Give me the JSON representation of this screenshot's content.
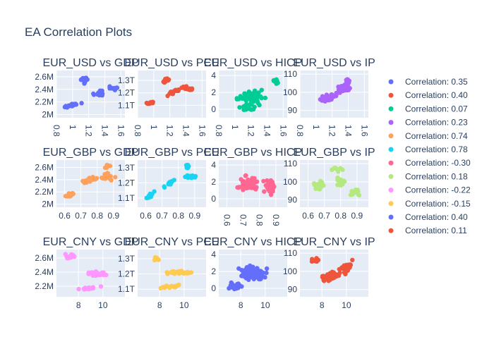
{
  "title": "EA Correlation Plots",
  "colors": {
    "plot_bg": "#e5ecf6",
    "grid": "#ffffff",
    "text": "#2a3f5f",
    "series": [
      "#636efa",
      "#ef553b",
      "#00cc96",
      "#ab63fa",
      "#ffa15a",
      "#19d3f3",
      "#ff6692",
      "#b6e880",
      "#ff97ff",
      "#fecb52",
      "#636efa",
      "#ef553b"
    ]
  },
  "legend": {
    "placement": "right",
    "entries": [
      "Correlation: 0.35",
      "Correlation: 0.40",
      "Correlation: 0.07",
      "Correlation: 0.23",
      "Correlation: 0.74",
      "Correlation: 0.78",
      "Correlation: -0.30",
      "Correlation: 0.18",
      "Correlation: -0.22",
      "Correlation: -0.15",
      "Correlation: 0.40",
      "Correlation: 0.11"
    ]
  },
  "chart_data": [
    {
      "type": "scatter",
      "title": "EUR_USD vs GDP",
      "xlim": [
        0.8,
        1.65
      ],
      "ylim": [
        1.95,
        2.7
      ],
      "xticks": [
        {
          "v": 0.8,
          "t": "0.8"
        },
        {
          "v": 1,
          "t": "1"
        },
        {
          "v": 1.2,
          "t": "1.2"
        },
        {
          "v": 1.4,
          "t": "1.4"
        },
        {
          "v": 1.6,
          "t": "1.6"
        }
      ],
      "yticks": [
        {
          "v": 2.0,
          "t": "2M"
        },
        {
          "v": 2.2,
          "t": "2.2M"
        },
        {
          "v": 2.4,
          "t": "2.4M"
        },
        {
          "v": 2.6,
          "t": "2.6M"
        }
      ],
      "xtick_rotate": true,
      "gen": "usd_gdp"
    },
    {
      "type": "scatter",
      "title": "EUR_USD vs PCE",
      "xlim": [
        0.8,
        1.65
      ],
      "ylim": [
        1.0,
        1.38
      ],
      "xticks": [
        {
          "v": 0.8,
          "t": "0.8"
        },
        {
          "v": 1,
          "t": "1"
        },
        {
          "v": 1.2,
          "t": "1.2"
        },
        {
          "v": 1.4,
          "t": "1.4"
        },
        {
          "v": 1.6,
          "t": "1.6"
        }
      ],
      "yticks": [
        {
          "v": 1.1,
          "t": "1.1T"
        },
        {
          "v": 1.2,
          "t": "1.2T"
        },
        {
          "v": 1.3,
          "t": "1.3T"
        }
      ],
      "xtick_rotate": true,
      "gen": "usd_pce"
    },
    {
      "type": "scatter",
      "title": "EUR_USD vs HICP",
      "xlim": [
        0.8,
        1.65
      ],
      "ylim": [
        -1,
        4.6
      ],
      "xticks": [
        {
          "v": 0.8,
          "t": "0.8"
        },
        {
          "v": 1,
          "t": "1"
        },
        {
          "v": 1.2,
          "t": "1.2"
        },
        {
          "v": 1.4,
          "t": "1.4"
        },
        {
          "v": 1.6,
          "t": "1.6"
        }
      ],
      "yticks": [
        {
          "v": 0,
          "t": "0"
        },
        {
          "v": 2,
          "t": "2"
        },
        {
          "v": 4,
          "t": "4"
        }
      ],
      "xtick_rotate": true,
      "gen": "usd_hicp"
    },
    {
      "type": "scatter",
      "title": "EUR_USD vs IP",
      "xlim": [
        0.8,
        1.65
      ],
      "ylim": [
        86,
        112
      ],
      "xticks": [
        {
          "v": 0.8,
          "t": "0.8"
        },
        {
          "v": 1,
          "t": "1"
        },
        {
          "v": 1.2,
          "t": "1.2"
        },
        {
          "v": 1.4,
          "t": "1.4"
        },
        {
          "v": 1.6,
          "t": "1.6"
        }
      ],
      "yticks": [
        {
          "v": 90,
          "t": "90"
        },
        {
          "v": 100,
          "t": "100"
        },
        {
          "v": 110,
          "t": "110"
        }
      ],
      "xtick_rotate": true,
      "gen": "usd_ip"
    },
    {
      "type": "scatter",
      "title": "EUR_GBP vs GDP",
      "xlim": [
        0.55,
        0.97
      ],
      "ylim": [
        1.95,
        2.72
      ],
      "xticks": [
        {
          "v": 0.6,
          "t": "0.6"
        },
        {
          "v": 0.7,
          "t": "0.7"
        },
        {
          "v": 0.8,
          "t": "0.8"
        },
        {
          "v": 0.9,
          "t": "0.9"
        }
      ],
      "yticks": [
        {
          "v": 2.0,
          "t": "2M"
        },
        {
          "v": 2.2,
          "t": "2.2M"
        },
        {
          "v": 2.4,
          "t": "2.4M"
        },
        {
          "v": 2.6,
          "t": "2.6M"
        }
      ],
      "xtick_rotate": false,
      "gen": "gbp_gdp"
    },
    {
      "type": "scatter",
      "title": "EUR_GBP vs PCE",
      "xlim": [
        0.55,
        0.97
      ],
      "ylim": [
        1.04,
        1.35
      ],
      "xticks": [
        {
          "v": 0.6,
          "t": "0.6"
        },
        {
          "v": 0.7,
          "t": "0.7"
        },
        {
          "v": 0.8,
          "t": "0.8"
        },
        {
          "v": 0.9,
          "t": "0.9"
        }
      ],
      "yticks": [
        {
          "v": 1.1,
          "t": "1.1T"
        },
        {
          "v": 1.2,
          "t": "1.2T"
        },
        {
          "v": 1.3,
          "t": "1.3T"
        }
      ],
      "xtick_rotate": false,
      "gen": "gbp_pce"
    },
    {
      "type": "scatter",
      "title": "EUR_GBP vs HICP",
      "xlim": [
        0.55,
        0.97
      ],
      "ylim": [
        -1,
        4.6
      ],
      "xticks": [
        {
          "v": 0.6,
          "t": "0.6"
        },
        {
          "v": 0.7,
          "t": "0.7"
        },
        {
          "v": 0.8,
          "t": "0.8"
        },
        {
          "v": 0.9,
          "t": "0.9"
        }
      ],
      "yticks": [
        {
          "v": 0,
          "t": "0"
        },
        {
          "v": 2,
          "t": "2"
        },
        {
          "v": 4,
          "t": "4"
        }
      ],
      "xtick_rotate": true,
      "gen": "gbp_hicp"
    },
    {
      "type": "scatter",
      "title": "EUR_GBP vs IP",
      "xlim": [
        0.55,
        0.97
      ],
      "ylim": [
        86,
        112
      ],
      "xticks": [
        {
          "v": 0.6,
          "t": "0.6"
        },
        {
          "v": 0.7,
          "t": "0.7"
        },
        {
          "v": 0.8,
          "t": "0.8"
        },
        {
          "v": 0.9,
          "t": "0.9"
        }
      ],
      "yticks": [
        {
          "v": 90,
          "t": "90"
        },
        {
          "v": 100,
          "t": "100"
        },
        {
          "v": 110,
          "t": "110"
        }
      ],
      "xtick_rotate": false,
      "gen": "gbp_ip"
    },
    {
      "type": "scatter",
      "title": "EUR_CNY vs GDP",
      "xlim": [
        6.2,
        11.8
      ],
      "ylim": [
        2.05,
        2.72
      ],
      "xticks": [
        {
          "v": 8,
          "t": "8"
        },
        {
          "v": 10,
          "t": "10"
        }
      ],
      "yticks": [
        {
          "v": 2.2,
          "t": "2.2M"
        },
        {
          "v": 2.4,
          "t": "2.4M"
        },
        {
          "v": 2.6,
          "t": "2.6M"
        }
      ],
      "xtick_rotate": false,
      "gen": "cny_gdp"
    },
    {
      "type": "scatter",
      "title": "EUR_CNY vs PCE",
      "xlim": [
        6.2,
        11.8
      ],
      "ylim": [
        1.05,
        1.36
      ],
      "xticks": [
        {
          "v": 8,
          "t": "8"
        },
        {
          "v": 10,
          "t": "10"
        }
      ],
      "yticks": [
        {
          "v": 1.1,
          "t": "1.1T"
        },
        {
          "v": 1.2,
          "t": "1.2T"
        },
        {
          "v": 1.3,
          "t": "1.3T"
        }
      ],
      "xtick_rotate": false,
      "gen": "cny_pce"
    },
    {
      "type": "scatter",
      "title": "EUR_CNY vs HICP",
      "xlim": [
        6.2,
        11.8
      ],
      "ylim": [
        -1,
        4.6
      ],
      "xticks": [
        {
          "v": 8,
          "t": "8"
        },
        {
          "v": 10,
          "t": "10"
        }
      ],
      "yticks": [
        {
          "v": 0,
          "t": "0"
        },
        {
          "v": 2,
          "t": "2"
        },
        {
          "v": 4,
          "t": "4"
        }
      ],
      "xtick_rotate": false,
      "gen": "cny_hicp"
    },
    {
      "type": "scatter",
      "title": "EUR_CNY vs IP",
      "xlim": [
        6.2,
        11.8
      ],
      "ylim": [
        86,
        112
      ],
      "xticks": [
        {
          "v": 8,
          "t": "8"
        },
        {
          "v": 10,
          "t": "10"
        }
      ],
      "yticks": [
        {
          "v": 90,
          "t": "90"
        },
        {
          "v": 100,
          "t": "100"
        },
        {
          "v": 110,
          "t": "110"
        }
      ],
      "xtick_rotate": false,
      "gen": "cny_ip"
    }
  ]
}
